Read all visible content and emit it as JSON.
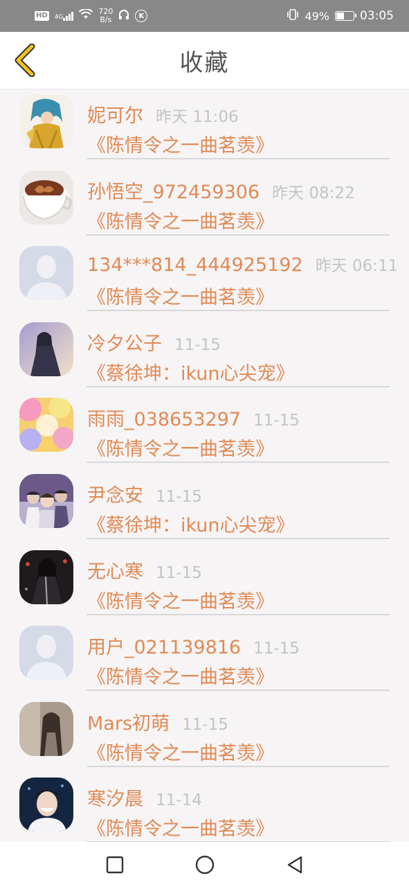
{
  "status_bar": {
    "badge": "HD",
    "network": "4G",
    "speed_value": "720",
    "speed_unit": "B/s",
    "vibrate_icon": "vibrate-icon",
    "battery_percent": "49%",
    "battery_level": 0.49,
    "time": "03:05"
  },
  "header": {
    "title": "收藏",
    "back_icon": "chevron-left-icon"
  },
  "list": [
    {
      "name": "妮可尔",
      "time": "昨天 11:06",
      "book": "《陈情令之一曲茗羡》",
      "avatar": "anime-golden-knight"
    },
    {
      "name": "孙悟空_972459306",
      "time": "昨天 08:22",
      "book": "《陈情令之一曲茗羡》",
      "avatar": "coffee-cup"
    },
    {
      "name": "134***814_444925192",
      "time": "昨天 06:11",
      "book": "《陈情令之一曲茗羡》",
      "avatar": "default-user"
    },
    {
      "name": "冷夕公子",
      "time": "11-15",
      "book": "《蔡徐坤：ikun心尖宠》",
      "avatar": "anime-dark-figure"
    },
    {
      "name": "雨雨_038653297",
      "time": "11-15",
      "book": "《陈情令之一曲茗羡》",
      "avatar": "colorful-blur"
    },
    {
      "name": "尹念安",
      "time": "11-15",
      "book": "《蔡徐坤：ikun心尖宠》",
      "avatar": "group-photo"
    },
    {
      "name": "无心寒",
      "time": "11-15",
      "book": "《陈情令之一曲茗羡》",
      "avatar": "anime-black-robe"
    },
    {
      "name": "用户_021139816",
      "time": "11-15",
      "book": "《陈情令之一曲茗羡》",
      "avatar": "default-user"
    },
    {
      "name": "Mars初萌",
      "time": "11-15",
      "book": "《陈情令之一曲茗羡》",
      "avatar": "girl-long-hair"
    },
    {
      "name": "寒汐晨",
      "time": "11-14",
      "book": "《陈情令之一曲茗羡》",
      "avatar": "smiling-man"
    }
  ],
  "nav_bar": {
    "recents_icon": "square-icon",
    "home_icon": "circle-icon",
    "back_icon": "triangle-back-icon"
  },
  "colors": {
    "accent": "#e08a55",
    "timestamp": "#c4c4c4",
    "title": "#555555",
    "back_arrow": "#f2c51b"
  }
}
